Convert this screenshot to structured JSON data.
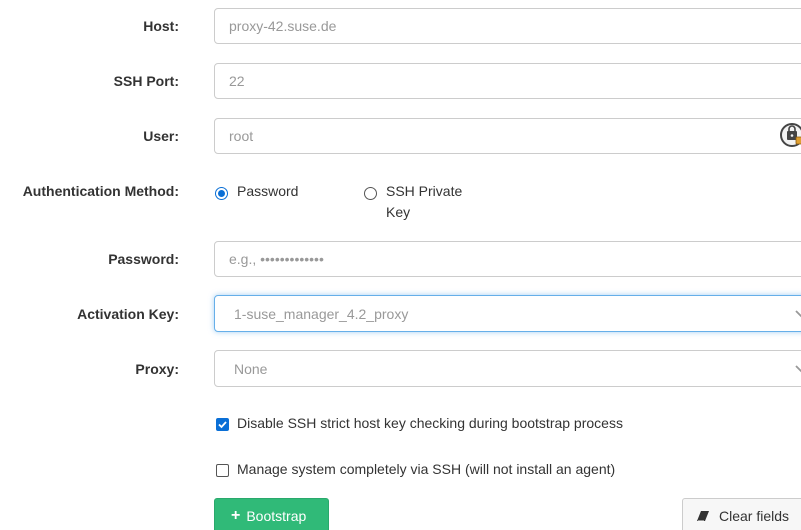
{
  "form": {
    "host": {
      "label": "Host:",
      "placeholder": "proxy-42.suse.de"
    },
    "ssh_port": {
      "label": "SSH Port:",
      "placeholder": "22"
    },
    "user": {
      "label": "User:",
      "placeholder": "root"
    },
    "auth_method": {
      "label": "Authentication Method:",
      "options": [
        {
          "label": "Password",
          "selected": true
        },
        {
          "label_line1": "SSH Private",
          "label_line2": "Key",
          "selected": false
        }
      ]
    },
    "password": {
      "label": "Password:",
      "placeholder": "e.g., •••••••••••••"
    },
    "activation_key": {
      "label": "Activation Key:",
      "value": "1-suse_manager_4.2_proxy"
    },
    "proxy": {
      "label": "Proxy:",
      "value": "None"
    },
    "options": {
      "disable_strict_host_key": {
        "label": "Disable SSH strict host key checking during bootstrap process",
        "checked": true
      },
      "manage_via_ssh": {
        "label": "Manage system completely via SSH (will not install an agent)",
        "checked": false
      }
    }
  },
  "actions": {
    "bootstrap_label": "Bootstrap",
    "clear_label": "Clear fields"
  },
  "icons": {
    "bootstrap": "plus-icon",
    "clear": "eraser-icon",
    "user_field": "keyboard-lock-icon",
    "select": "chevron-down-icon"
  },
  "colors": {
    "primary_button": "#30ba78",
    "radio_checkbox_accent": "#0a6fd6",
    "focus_border": "#66afe9"
  }
}
